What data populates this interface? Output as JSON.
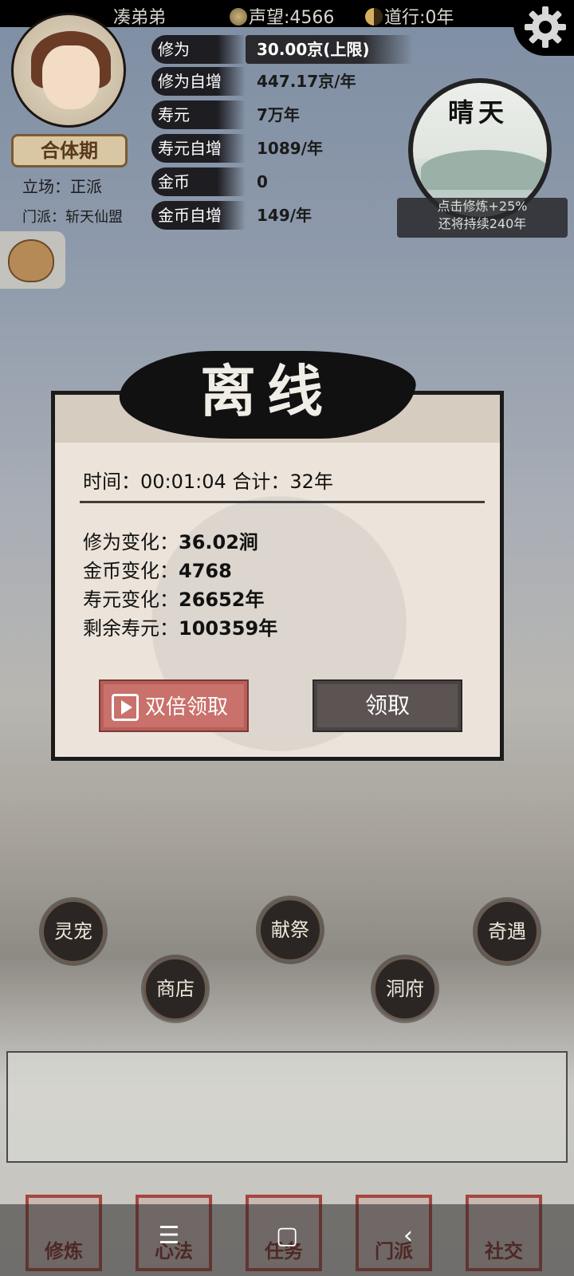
{
  "statusbar": {
    "username": "凑弟弟",
    "reputation": "声望:4566",
    "daoxing": "道行:0年"
  },
  "player": {
    "realm": "合体期",
    "stance": "立场：正派",
    "sect": "门派：斩天仙盟"
  },
  "stats": [
    {
      "label": "修为",
      "value": "30.00京(上限)"
    },
    {
      "label": "修为自增",
      "value": "447.17京/年"
    },
    {
      "label": "寿元",
      "value": "7万年"
    },
    {
      "label": "寿元自增",
      "value": "1089/年"
    },
    {
      "label": "金币",
      "value": "0"
    },
    {
      "label": "金币自增",
      "value": "149/年"
    }
  ],
  "weather": {
    "title": "晴天",
    "line1": "点击修炼+25%",
    "line2": "还将持续240年"
  },
  "dialog": {
    "title": "离线",
    "time_line": "时间：00:01:04  合计：32年",
    "changes": [
      {
        "label": "修为变化：",
        "value": "36.02涧"
      },
      {
        "label": "金币变化：",
        "value": "4768"
      },
      {
        "label": "寿元变化：",
        "value": "26652年"
      },
      {
        "label": "剩余寿元：",
        "value": "100359年"
      }
    ],
    "double_button": "双倍领取",
    "claim_button": "领取"
  },
  "actions": [
    "灵宠",
    "献祭",
    "奇遇",
    "商店",
    "洞府"
  ],
  "tabs": [
    "修炼",
    "心法",
    "任务",
    "门派",
    "社交"
  ],
  "colors": {
    "accent_red": "#c9716b",
    "dialog_bg": "#ece4da",
    "dark": "#1d1d22"
  }
}
